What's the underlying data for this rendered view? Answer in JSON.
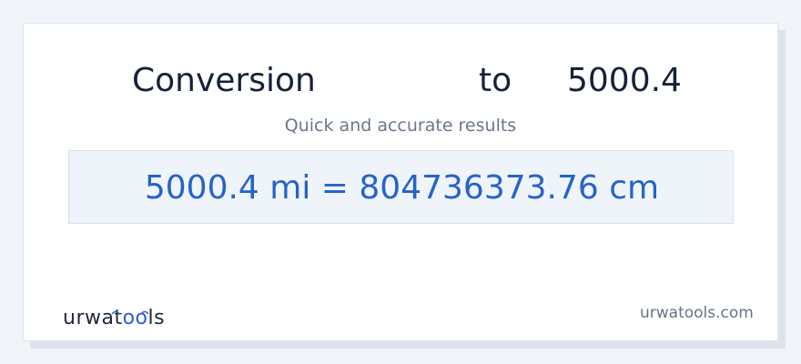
{
  "heading": {
    "word": "Conversion",
    "connector": "to",
    "value": "5000.4"
  },
  "subtitle": "Quick and accurate results",
  "result": "5000.4 mi = 804736373.76 cm",
  "logo": {
    "part1": "urwat",
    "part2": "oo",
    "part3": "ls"
  },
  "site_url": "urwatools.com",
  "colors": {
    "accent": "#2563c9",
    "title": "#16213a",
    "muted": "#6a778a",
    "result_bg": "#eff4fa"
  }
}
